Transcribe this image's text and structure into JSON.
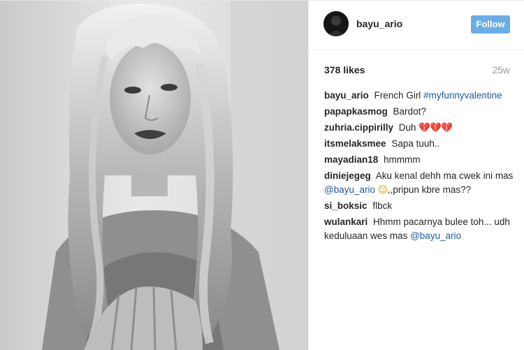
{
  "post": {
    "username": "bayu_ario",
    "follow_label": "Follow",
    "likes": "378 likes",
    "age": "25w"
  },
  "comments": [
    {
      "user": "bayu_ario",
      "text": "French Girl",
      "link": "#myfunnyvalentine"
    },
    {
      "user": "papapkasmog",
      "text": "Bardot?"
    },
    {
      "user": "zuhria.cippirilly",
      "text": "Duh",
      "emoji": "💔💔💔"
    },
    {
      "user": "itsmelaksmee",
      "text": "Sapa tuuh.."
    },
    {
      "user": "mayadian18",
      "text": "hmmmm"
    },
    {
      "user": "diniejegeg",
      "text": "Aku kenal dehh ma cwek ini mas",
      "link": "@bayu_ario",
      "emoji": "😉",
      "text2": ",,pripun kbre mas??"
    },
    {
      "user": "si_boksic",
      "text": "flbck"
    },
    {
      "user": "wulankari",
      "text": "Hhmm pacarnya bulee toh... udh keduluaan wes mas",
      "link": "@bayu_ario"
    }
  ],
  "colors": {
    "follow_button": "#6aaee6",
    "link": "#1e5aa8",
    "muted": "#9a9a9a"
  },
  "icons": [
    "broken-heart-icon",
    "wink-emoji-icon"
  ]
}
